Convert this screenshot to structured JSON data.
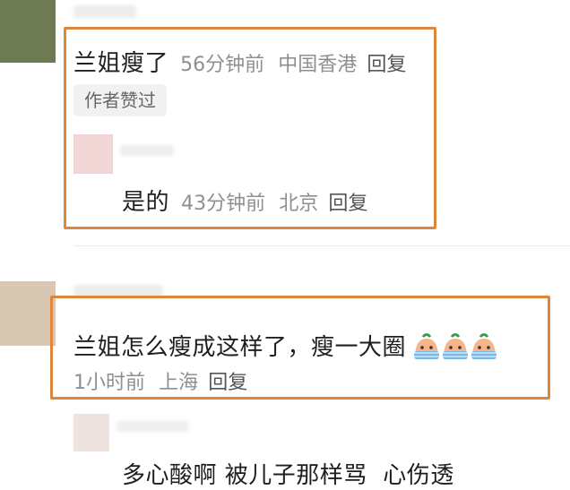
{
  "comments": [
    {
      "text": "兰姐瘦了",
      "time": "56分钟前",
      "location": "中国香港",
      "reply_label": "回复",
      "badge": "作者赞过"
    },
    {
      "text": "是的",
      "time": "43分钟前",
      "location": "北京",
      "reply_label": "回复"
    },
    {
      "text": "兰姐怎么瘦成这样了，瘦一大圈",
      "emoji": "crying-face-emoji",
      "time": "1小时前",
      "location": "上海",
      "reply_label": "回复"
    },
    {
      "text": "多心酸啊 被儿子那样骂  心伤透"
    }
  ],
  "colors": {
    "highlight_border": "#e0863a",
    "meta_text": "#8f8f8f"
  }
}
